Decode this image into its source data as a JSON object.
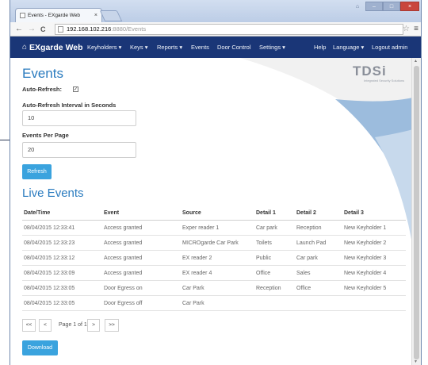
{
  "browser": {
    "tab_title": "Events - EXgarde Web",
    "tab_close": "×",
    "back_glyph": "←",
    "forward_glyph": "→",
    "reload_glyph": "C",
    "url_host": "192.168.102.216",
    "url_rest": ":8880/Events",
    "star_glyph": "☆",
    "menu_glyph": "≡",
    "user_glyph": "⌂",
    "min_glyph": "–",
    "max_glyph": "□",
    "close_glyph": "×"
  },
  "navbar": {
    "brand": "EXgarde Web",
    "home_glyph": "⌂",
    "items": [
      "Keyholders ▾",
      "Keys ▾",
      "Reports ▾",
      "Events",
      "Door Control",
      "Settings ▾",
      "Help",
      "Language ▾",
      "Logout admin"
    ]
  },
  "logo": {
    "text": "TDSi",
    "tagline": "Integrated Security Solutions"
  },
  "page": {
    "title": "Events",
    "auto_refresh_label": "Auto-Refresh:",
    "auto_refresh_checked": true,
    "check_glyph": "✓",
    "interval_label": "Auto-Refresh Interval in Seconds",
    "interval_value": "10",
    "per_page_label": "Events Per Page",
    "per_page_value": "20",
    "refresh_button": "Refresh",
    "live_title": "Live Events",
    "download_button": "Download"
  },
  "table": {
    "headers": [
      "Date/Time",
      "Event",
      "Source",
      "Detail 1",
      "Detail 2",
      "Detail 3"
    ],
    "rows": [
      [
        "08/04/2015 12:33:41",
        "Access granted",
        "Exper reader 1",
        "Car park",
        "Reception",
        "New Keyholder 1"
      ],
      [
        "08/04/2015 12:33:23",
        "Access granted",
        "MICROgarde Car Park",
        "Toilets",
        "Launch Pad",
        "New Keyholder 2"
      ],
      [
        "08/04/2015 12:33:12",
        "Access granted",
        "EX reader 2",
        "Public",
        "Car park",
        "New Keyholder 3"
      ],
      [
        "08/04/2015 12:33:09",
        "Access granted",
        "EX reader 4",
        "Office",
        "Sales",
        "New Keyholder 4"
      ],
      [
        "08/04/2015 12:33:05",
        "Door Egress on",
        "Car Park",
        "Reception",
        "Office",
        "New Keyholder 5"
      ],
      [
        "08/04/2015 12:33:05",
        "Door Egress off",
        "Car Park",
        "",
        "",
        ""
      ]
    ]
  },
  "pagination": {
    "first": "<<",
    "prev": "<",
    "label": "Page 1 of 1",
    "next": ">",
    "last": ">>"
  },
  "colors": {
    "navbar": "#1a3677",
    "accent": "#2a7bbf",
    "button": "#3aa3de"
  }
}
